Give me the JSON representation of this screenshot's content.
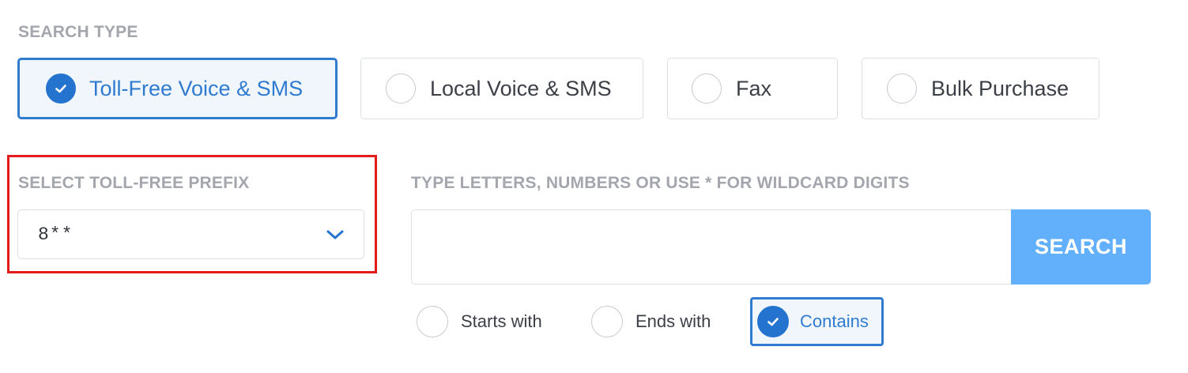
{
  "search_type": {
    "label": "SEARCH TYPE",
    "options": [
      {
        "label": "Toll-Free Voice & SMS",
        "selected": true
      },
      {
        "label": "Local Voice & SMS",
        "selected": false
      },
      {
        "label": "Fax",
        "selected": false
      },
      {
        "label": "Bulk Purchase",
        "selected": false
      }
    ]
  },
  "prefix": {
    "label": "SELECT TOLL-FREE PREFIX",
    "value": "8**"
  },
  "pattern": {
    "label": "TYPE LETTERS, NUMBERS OR USE * FOR WILDCARD DIGITS",
    "input_value": "",
    "search_button_label": "SEARCH"
  },
  "match_mode": {
    "options": [
      {
        "label": "Starts with",
        "selected": false
      },
      {
        "label": "Ends with",
        "selected": false
      },
      {
        "label": "Contains",
        "selected": true
      }
    ]
  },
  "colors": {
    "accent": "#2f7bd0",
    "search_button": "#62b0fb",
    "highlight": "#e31b1b",
    "label_gray": "#a3a6ad"
  }
}
